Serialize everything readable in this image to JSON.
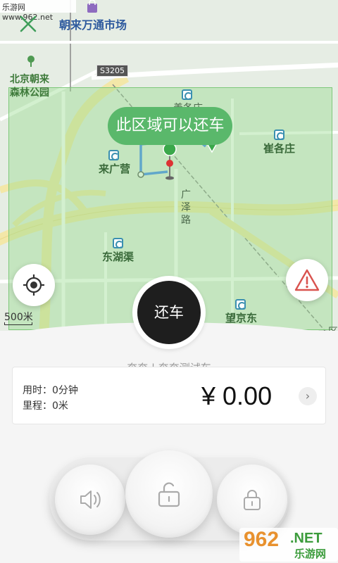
{
  "status_watermark": "乐游网 www.962.net",
  "map": {
    "poi_top": "朝来万通市场",
    "park_label_line1": "北京朝来",
    "park_label_line2": "森林公园",
    "road_code": "S3205",
    "labels": {
      "shangezhuang": "善各庄",
      "laiguangying": "来广营",
      "cuigezhuang": "崔各庄",
      "guangze_road_1": "广",
      "guangze_road_2": "泽",
      "guangze_road_3": "路",
      "donghuqu": "东湖渠",
      "wangjingdong": "望京东",
      "partial_right": "一区"
    },
    "zone_tooltip": "此区域可以还车",
    "scale_label": "500米"
  },
  "actions": {
    "return_car": "还车"
  },
  "trip": {
    "vehicle_name": "奔奔 | 奔奔测试车",
    "time_label": "用时：0分钟",
    "distance_label": "里程：0米",
    "price": "¥ 0.00",
    "detail_chevron": "›"
  },
  "watermark": {
    "brand_digits": "962",
    "brand_net": ".NET",
    "brand_cn": "乐游网"
  },
  "colors": {
    "accent_green": "#5ab86b",
    "zone_fill": "#96dc8c",
    "warning_red": "#d9534f",
    "button_dark": "#1e1e1e"
  },
  "icons": {
    "close": "close-icon",
    "locate": "locate-icon",
    "warning": "warning-icon",
    "sound": "speaker-icon",
    "unlock": "unlock-icon",
    "lock": "lock-icon"
  }
}
